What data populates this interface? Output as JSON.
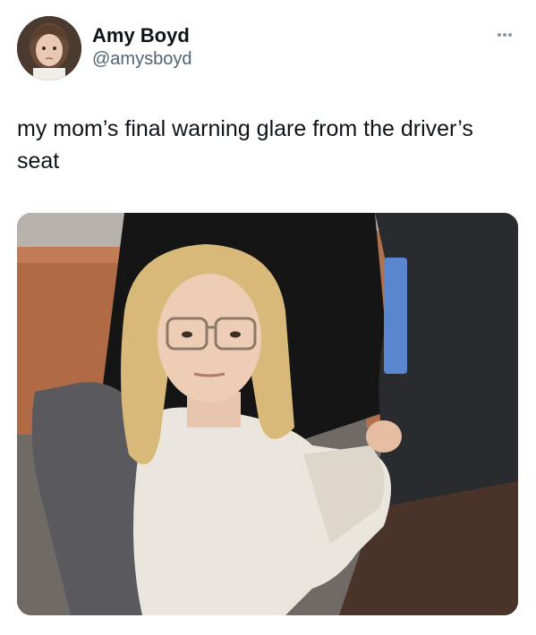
{
  "author": {
    "display_name": "Amy Boyd",
    "handle": "@amysboyd",
    "avatar_icon": "avatar-photo"
  },
  "menu": {
    "icon": "more-options-icon"
  },
  "tweet": {
    "text": "my mom’s final warning glare from the driver’s seat"
  },
  "media": {
    "type": "photo"
  },
  "colors": {
    "text": "#0f1419",
    "secondary": "#536471",
    "icon": "#8b98a5"
  }
}
